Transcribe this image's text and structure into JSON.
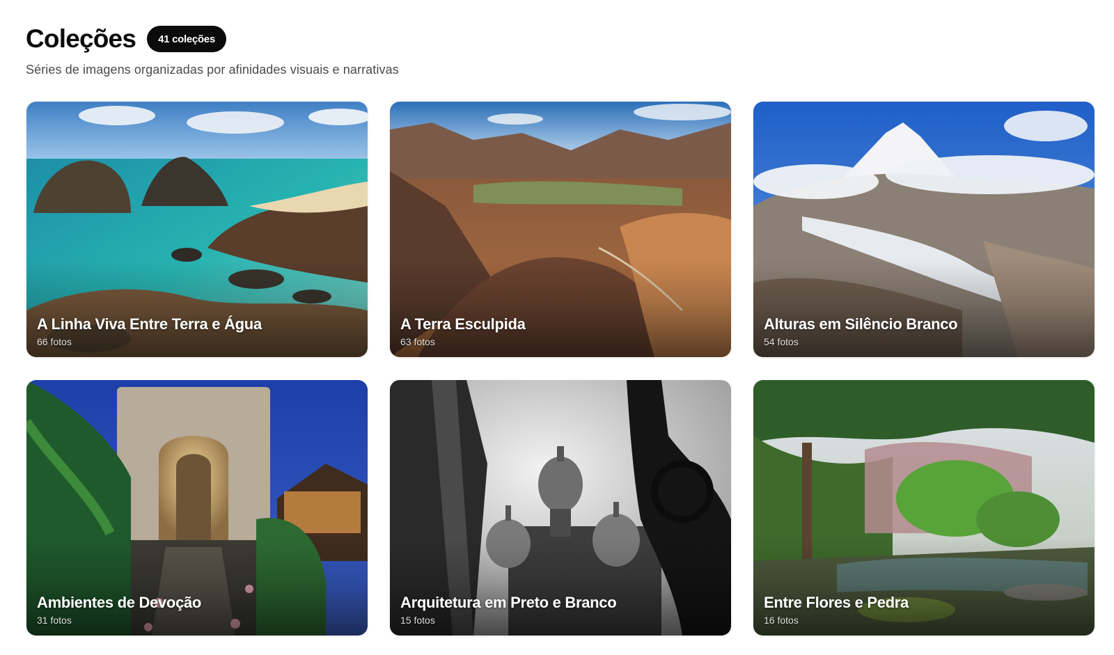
{
  "header": {
    "title": "Coleções",
    "badge": "41 coleções",
    "subtitle": "Séries de imagens organizadas por afinidades visuais e narrativas"
  },
  "collections": [
    {
      "title": "A Linha Viva Entre Terra e Água",
      "count": "66 fotos",
      "scene": "coastal-rocks-sea"
    },
    {
      "title": "A Terra Esculpida",
      "count": "63 fotos",
      "scene": "desert-mountains-valley"
    },
    {
      "title": "Alturas em Silêncio Branco",
      "count": "54 fotos",
      "scene": "snowy-peak-glacier"
    },
    {
      "title": "Ambientes de Devoção",
      "count": "31 fotos",
      "scene": "temple-gate-night"
    },
    {
      "title": "Arquitetura em Preto e Branco",
      "count": "15 fotos",
      "scene": "onion-domes-monochrome"
    },
    {
      "title": "Entre Flores e Pedra",
      "count": "16 fotos",
      "scene": "japanese-garden-pond"
    }
  ],
  "colors": {
    "badge_bg": "#0b0b0b",
    "title": "#0b0b0b",
    "subtitle": "#4a4a4a"
  }
}
